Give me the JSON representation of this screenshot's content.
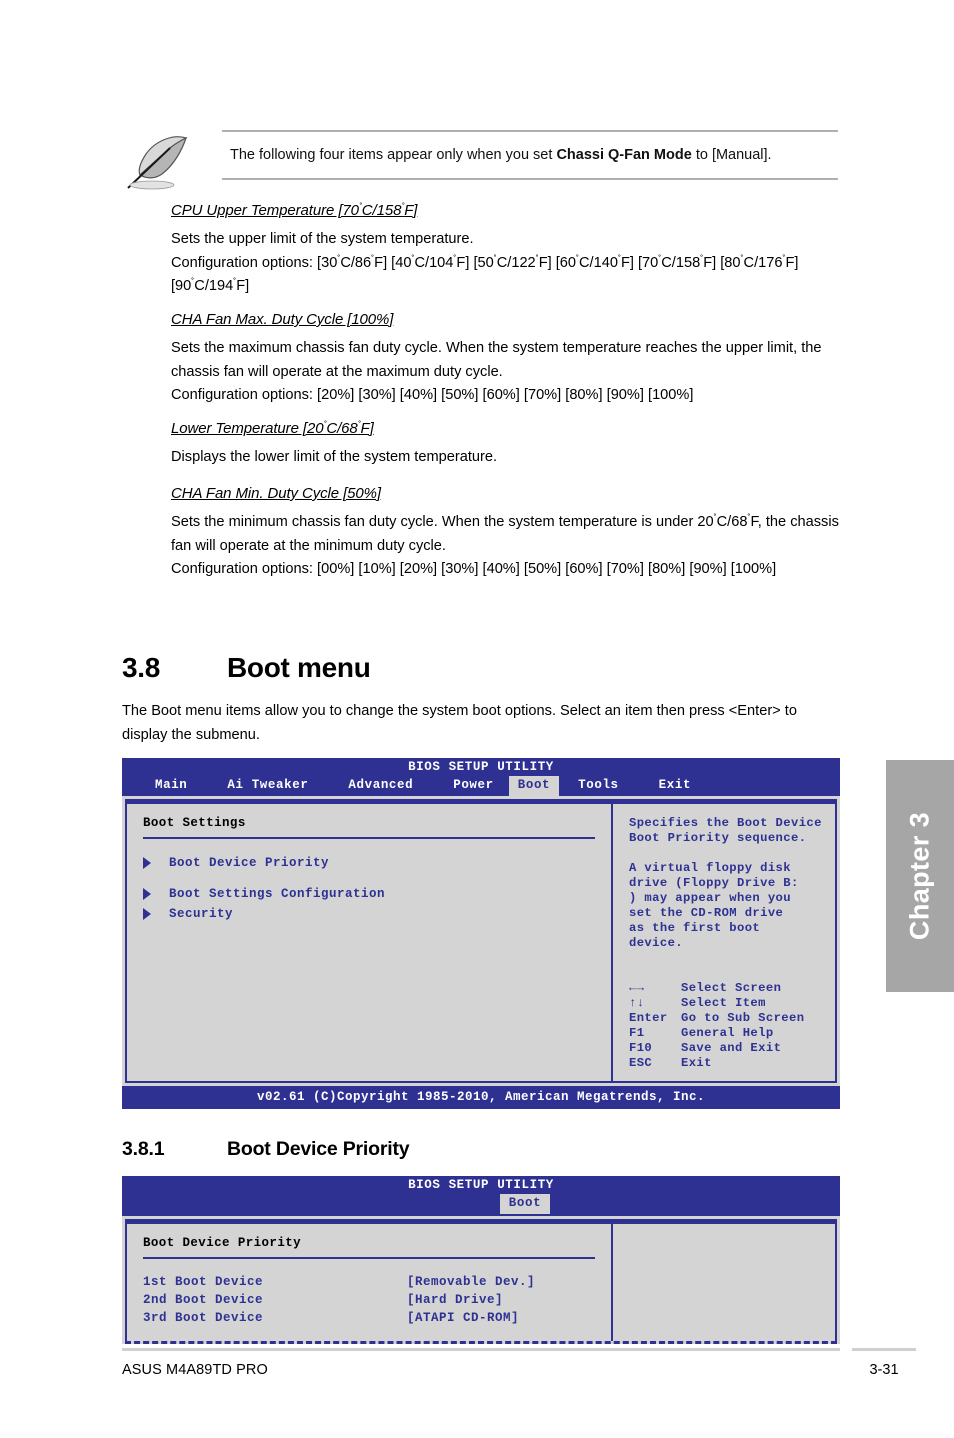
{
  "note": {
    "icon": "feather-pen-icon",
    "text_before": "The following four items appear only when you set ",
    "text_bold": "Chassi Q-Fan Mode",
    "text_after": " to [Manual]."
  },
  "sections": [
    {
      "title": "CPU Upper Temperature [70˚C/158˚F]",
      "lines": [
        "Sets the upper limit of the system temperature.",
        "Configuration options: [30˚C/86˚F] [40˚C/104˚F] [50˚C/122˚F] [60˚C/140˚F] [70˚C/158˚F] [80˚C/176˚F] [90˚C/194˚F]"
      ]
    },
    {
      "title": "CHA Fan Max. Duty Cycle [100%]",
      "lines": [
        "Sets the maximum chassis fan duty cycle. When the system temperature reaches the upper limit, the chassis fan will operate at the maximum duty cycle.",
        "Configuration options: [20%] [30%] [40%] [50%] [60%] [70%] [80%] [90%] [100%]"
      ]
    },
    {
      "title": "Lower Temperature [20˚C/68˚F]",
      "lines": [
        "Displays the lower limit of the system temperature."
      ]
    },
    {
      "title": "CHA Fan Min. Duty Cycle [50%]",
      "lines": [
        "Sets the minimum chassis fan duty cycle. When the system temperature is under 20˚C/68˚F, the chassis fan will operate at the minimum duty cycle.",
        "Configuration options: [00%] [10%] [20%] [30%] [40%] [50%] [60%] [70%] [80%] [90%] [100%]"
      ]
    }
  ],
  "heading_main": {
    "number": "3.8",
    "title": "Boot menu"
  },
  "intro": "The Boot menu items allow you to change the system boot options. Select an item then press <Enter> to display the submenu.",
  "heading_sub": {
    "number": "3.8.1",
    "title": "Boot Device Priority"
  },
  "bios_boot_menu": {
    "title": "BIOS SETUP UTILITY",
    "tabs": [
      {
        "label": "Main",
        "active": false
      },
      {
        "label": "Ai Tweaker",
        "active": false
      },
      {
        "label": "Advanced",
        "active": false
      },
      {
        "label": "Power",
        "active": false
      },
      {
        "label": "Boot",
        "active": true
      },
      {
        "label": "Tools",
        "active": false
      },
      {
        "label": "Exit",
        "active": false
      }
    ],
    "panel_head": "Boot Settings",
    "menu_items": [
      "Boot Device Priority",
      "Boot Settings Configuration",
      "Security"
    ],
    "help_1": "Specifies the Boot Device\nBoot Priority sequence.",
    "help_2": "A virtual floppy disk\ndrive (Floppy Drive B:\n) may appear when you\nset the CD-ROM drive\nas the first boot\ndevice.",
    "keys": [
      {
        "key": "←→",
        "desc": "Select Screen"
      },
      {
        "key": "↑↓",
        "desc": "Select Item"
      },
      {
        "key": "Enter",
        "desc": "Go to Sub Screen"
      },
      {
        "key": "F1",
        "desc": "General Help"
      },
      {
        "key": "F10",
        "desc": "Save and Exit"
      },
      {
        "key": "ESC",
        "desc": "Exit"
      }
    ],
    "footer": "v02.61 (C)Copyright 1985-2010, American Megatrends, Inc."
  },
  "bios_boot_device": {
    "title": "BIOS SETUP UTILITY",
    "tab_active": "Boot",
    "panel_head": "Boot Device Priority",
    "devices": [
      {
        "name": "1st Boot Device",
        "value": "[Removable Dev.]"
      },
      {
        "name": "2nd Boot Device",
        "value": "[Hard Drive]"
      },
      {
        "name": "3rd Boot Device",
        "value": "[ATAPI CD-ROM]"
      }
    ]
  },
  "chapter_tab": "Chapter 3",
  "footer": {
    "product": "ASUS M4A89TD PRO",
    "page": "3-31"
  },
  "colors": {
    "bios_blue": "#2e3192",
    "bios_gray": "#d4d4d4",
    "chapter_gray": "#a6a6a6",
    "rule_gray": "#b0b0b0"
  }
}
